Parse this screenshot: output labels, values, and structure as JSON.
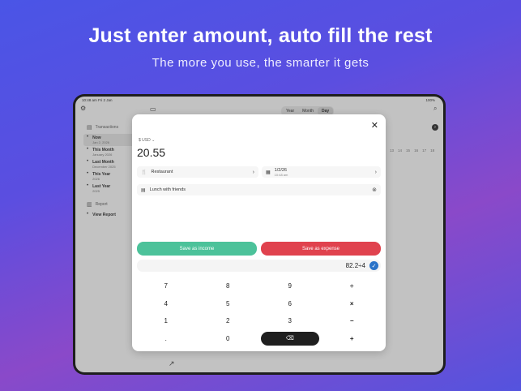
{
  "promo": {
    "headline": "Just enter amount, auto fill the rest",
    "subline": "The more you use, the smarter it gets"
  },
  "status": {
    "time": "10:48 am  Fri 2 Jan",
    "battery": "100%"
  },
  "view_segments": [
    {
      "label": "Year",
      "active": false
    },
    {
      "label": "Month",
      "active": false
    },
    {
      "label": "Day",
      "active": true
    }
  ],
  "sidebar": {
    "transactions_label": "Transactions",
    "items": [
      {
        "title": "Now",
        "date": "Jan 2, 2026"
      },
      {
        "title": "This Month",
        "date": "January 2026"
      },
      {
        "title": "Last Month",
        "date": "December 2025"
      },
      {
        "title": "This Year",
        "date": "2026"
      },
      {
        "title": "Last Year",
        "date": "2025"
      }
    ],
    "report_label": "Report",
    "view_report": "View Report"
  },
  "background_calendar": [
    "12",
    "13",
    "14",
    "15",
    "16",
    "17",
    "18"
  ],
  "modal": {
    "currency": "$ USD ⌄",
    "amount": "20.55",
    "category": "Restaurant",
    "date": "1/2/26",
    "time": "10:48 am",
    "note": "Lunch with friends",
    "save_income": "Save as income",
    "save_expense": "Save as expense",
    "expression": "82.2÷4",
    "keys": [
      "7",
      "8",
      "9",
      "÷",
      "4",
      "5",
      "6",
      "×",
      "1",
      "2",
      "3",
      "−",
      ".",
      "0",
      "⌫",
      "+"
    ]
  },
  "colors": {
    "income": "#4cc29a",
    "expense": "#e0424e",
    "check": "#2a73c8"
  }
}
